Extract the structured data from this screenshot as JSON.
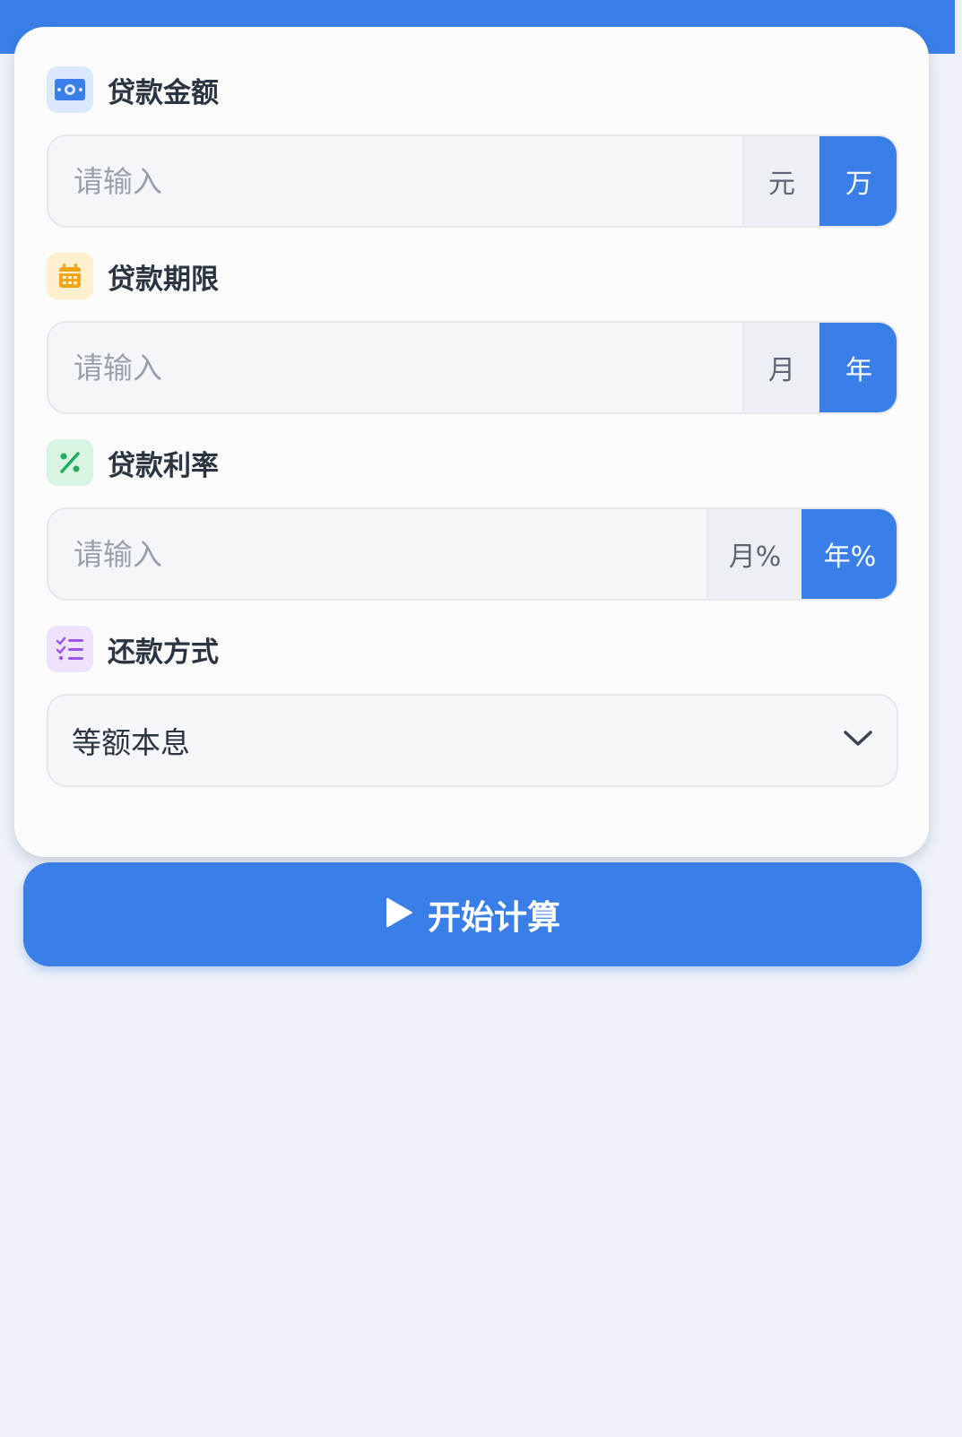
{
  "colors": {
    "primary": "#3a7ee8",
    "background": "#eef1f7",
    "card": "#fbfbfc"
  },
  "loan_amount": {
    "label": "贷款金额",
    "icon": "money-bill-icon",
    "placeholder": "请输入",
    "value": "",
    "units": [
      "元",
      "万"
    ],
    "selected_unit": "万"
  },
  "loan_term": {
    "label": "贷款期限",
    "icon": "calendar-icon",
    "placeholder": "请输入",
    "value": "",
    "units": [
      "月",
      "年"
    ],
    "selected_unit": "年"
  },
  "interest_rate": {
    "label": "贷款利率",
    "icon": "percent-icon",
    "placeholder": "请输入",
    "value": "",
    "units": [
      "月%",
      "年%"
    ],
    "selected_unit": "年%"
  },
  "repayment_method": {
    "label": "还款方式",
    "icon": "list-check-icon",
    "selected": "等额本息"
  },
  "start_button": {
    "label": "开始计算",
    "icon": "play-icon"
  }
}
